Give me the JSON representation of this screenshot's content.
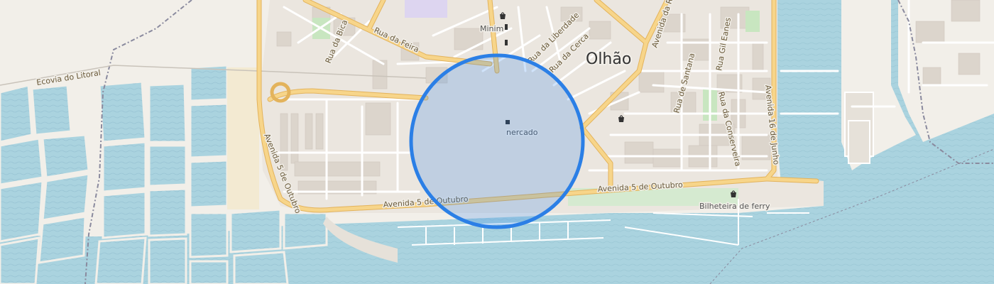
{
  "map": {
    "place_name": "Olhão",
    "poi_market": "nercado",
    "poi_shop": "Minim",
    "poi_ferry": "Bilheteira de ferry",
    "roads": {
      "ecovia": "Ecovia do Litoral",
      "bica": "Rua da Bica",
      "feira": "Rua da Feira",
      "liberdade": "Rua da Liberdade",
      "cerca": "Rua da Cerca",
      "avenida_top": "Avenida da R",
      "gil_eanes": "Rua Gil Eanes",
      "santana": "Rua de Santana",
      "conserveira": "Rua da Conserveira",
      "dezaseis_junho": "Avenida 16 de Junho",
      "outubro_west": "Avenida 5 de Outubro",
      "outubro_center": "Avenida 5 de Outubro",
      "outubro_east": "Avenida 5 de Outubro"
    },
    "colors": {
      "land": "#f2efe9",
      "water": "#aad3df",
      "salt_pans": "#b5d0e8",
      "road_major": "#f7d58a",
      "road_minor": "#ffffff",
      "building": "#dcd5cc",
      "park": "#c8e6c0",
      "selection_circle": "#2b7fe6"
    },
    "icons": [
      "shop-icon",
      "ferry-icon",
      "market-icon"
    ]
  }
}
